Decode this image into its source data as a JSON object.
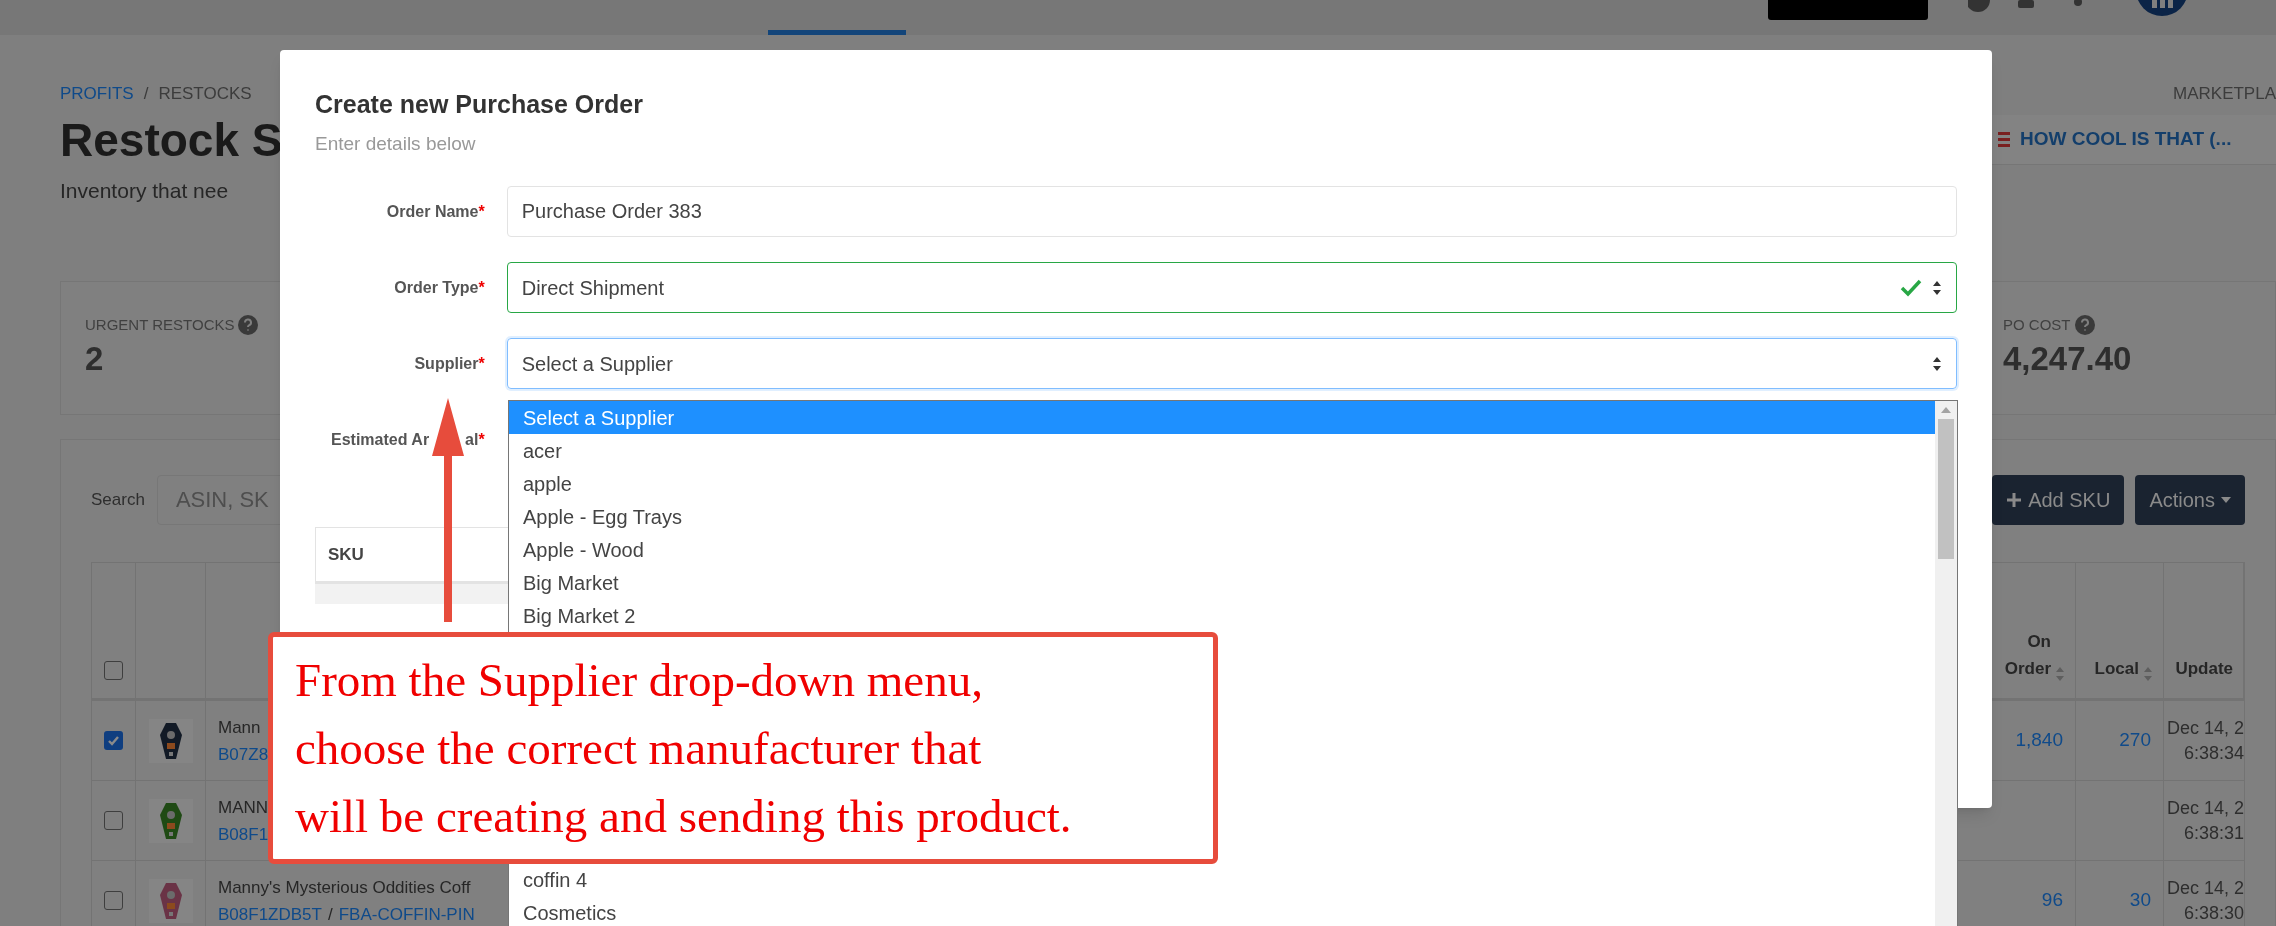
{
  "breadcrumb": [
    {
      "label": "PROFITS",
      "link": true
    },
    {
      "label": "RESTOCKS",
      "link": false
    }
  ],
  "breadcrumb_separator": "/",
  "marketplace_label": "MARKETPLA",
  "page_title": "Restock S",
  "page_subtitle": "Inventory that nee",
  "store_selector": "HOW COOL IS THAT (...",
  "stats": [
    {
      "label": "URGENT RESTOCKS",
      "value": "2"
    },
    {
      "label": "PO COST",
      "value": "4,247.40"
    }
  ],
  "search": {
    "label": "Search",
    "placeholder": "ASIN, SK"
  },
  "toolbar_buttons": [
    {
      "label": "Add SKU",
      "kind": "add"
    },
    {
      "label": "Actions",
      "kind": "menu"
    }
  ],
  "table": {
    "header_checked": false,
    "columns": [
      {
        "label": "On Order",
        "sortable": true
      },
      {
        "label": "Local",
        "sortable": true
      },
      {
        "label": "Update",
        "sortable": false
      }
    ],
    "rows": [
      {
        "checked": true,
        "title": "Mann",
        "asin": "B07Z8",
        "on_order": "1,840",
        "local": "270",
        "updated": [
          "Dec 14, 2",
          "6:38:34"
        ]
      },
      {
        "checked": false,
        "title": "MANN",
        "asin": "B08F1",
        "updated": [
          "Dec 14, 2",
          "6:38:31"
        ]
      },
      {
        "checked": false,
        "title": "Manny's Mysterious Oddities Coff",
        "asin": "B08F1ZDB5T",
        "separator": "/",
        "sku": "FBA-COFFIN-PIN",
        "on_order": "96",
        "local": "30",
        "updated": [
          "Dec 14, 2",
          "6:38:30"
        ]
      }
    ]
  },
  "modal": {
    "title": "Create new Purchase Order",
    "subtitle": "Enter details below",
    "fields": [
      {
        "label": "Order Name",
        "required_mark": "*",
        "kind": "text",
        "value": "Purchase Order 383",
        "valid": false,
        "focused": false
      },
      {
        "label": "Order Type",
        "required_mark": "*",
        "kind": "select",
        "value": "Direct Shipment",
        "valid": true,
        "focused": false
      },
      {
        "label": "Supplier",
        "required_mark": "*",
        "kind": "select",
        "value": "Select a Supplier",
        "valid": false,
        "focused": true
      },
      {
        "label": "Estimated Ar",
        "label_after_arrow": "al",
        "required_mark": "*",
        "kind": "date"
      }
    ],
    "table_header": "SKU",
    "dropdown": {
      "options": [
        {
          "label": "Select a Supplier",
          "selected": true
        },
        {
          "label": "acer",
          "selected": false
        },
        {
          "label": "apple",
          "selected": false
        },
        {
          "label": "Apple - Egg Trays",
          "selected": false
        },
        {
          "label": "Apple - Wood",
          "selected": false
        },
        {
          "label": "Big Market",
          "selected": false
        },
        {
          "label": "Big Market 2",
          "selected": false
        }
      ],
      "options_below_callout": [
        {
          "label": "coffin 4",
          "selected": false
        },
        {
          "label": "Cosmetics",
          "selected": false
        }
      ]
    }
  },
  "callout": {
    "lines": [
      "From the Supplier drop-down menu,",
      "choose the correct manufacturer that",
      "will be creating and sending this product."
    ]
  }
}
